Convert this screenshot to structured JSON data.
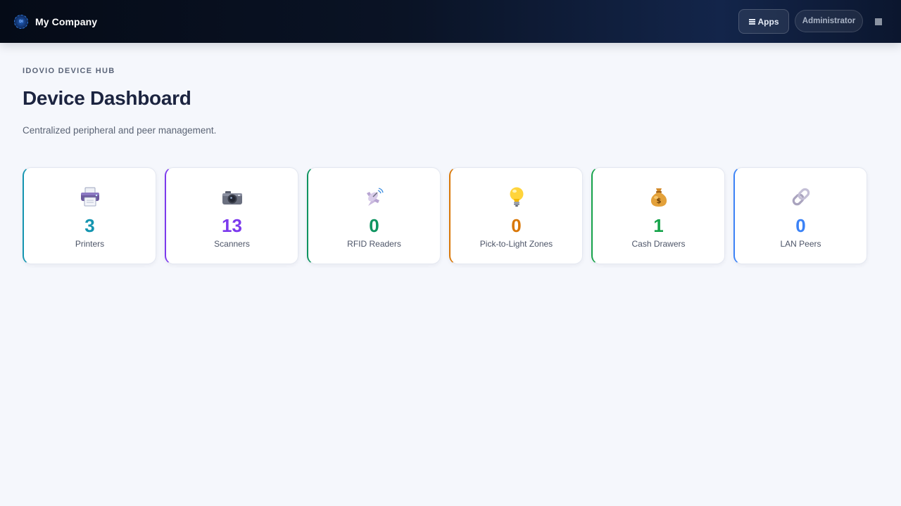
{
  "topbar": {
    "logo_text": "DI",
    "company_name": "My Company",
    "apps_label": "Apps",
    "user_label": "Administrator"
  },
  "header": {
    "eyebrow": "IDOVIO DEVICE HUB",
    "title": "Device Dashboard",
    "subtitle": "Centralized peripheral and peer management."
  },
  "cards": [
    {
      "icon": "printer-icon",
      "count": "3",
      "label": "Printers",
      "color": "#1495b0"
    },
    {
      "icon": "camera-icon",
      "count": "13",
      "label": "Scanners",
      "color": "#7c3aed"
    },
    {
      "icon": "satellite-antenna-icon",
      "count": "0",
      "label": "RFID Readers",
      "color": "#0e9460"
    },
    {
      "icon": "light-bulb-icon",
      "count": "0",
      "label": "Pick-to-Light Zones",
      "color": "#d97706"
    },
    {
      "icon": "money-bag-icon",
      "count": "1",
      "label": "Cash Drawers",
      "color": "#16a34a"
    },
    {
      "icon": "link-icon",
      "count": "0",
      "label": "LAN Peers",
      "color": "#3b82f6"
    }
  ]
}
